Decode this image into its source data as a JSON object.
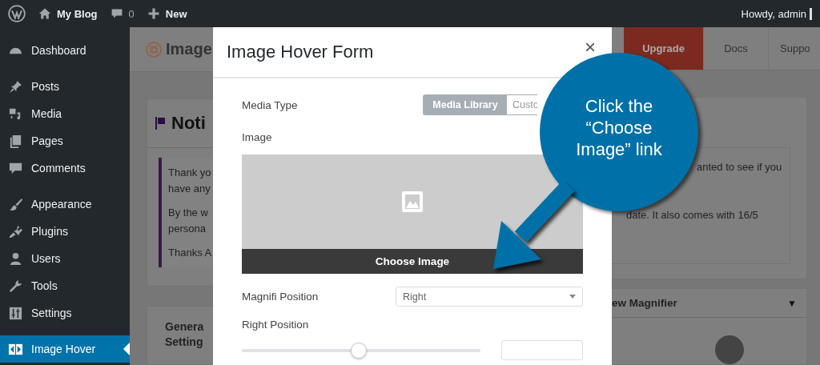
{
  "admin_bar": {
    "site_name": "My Blog",
    "comments_count": "0",
    "new_label": "New",
    "greeting": "Howdy, admin"
  },
  "sidebar": {
    "groups": [
      [
        {
          "label": "Dashboard",
          "selected": false
        }
      ],
      [
        {
          "label": "Posts",
          "selected": false
        },
        {
          "label": "Media",
          "selected": false
        },
        {
          "label": "Pages",
          "selected": false
        },
        {
          "label": "Comments",
          "selected": false
        }
      ],
      [
        {
          "label": "Appearance",
          "selected": false
        },
        {
          "label": "Plugins",
          "selected": false
        },
        {
          "label": "Users",
          "selected": false
        },
        {
          "label": "Tools",
          "selected": false
        },
        {
          "label": "Settings",
          "selected": false
        }
      ],
      [
        {
          "label": "Image Hover",
          "selected": true
        }
      ]
    ]
  },
  "background_page": {
    "logo_text": "Image",
    "tabs": [
      {
        "label": "Upgrade",
        "selected": true
      },
      {
        "label": "Docs",
        "selected": false
      },
      {
        "label": "Suppo",
        "selected": false
      }
    ],
    "notice": {
      "title": "Noti",
      "left_lines": [
        "Thank yo",
        "have any",
        "By the w",
        "persona",
        "Thanks A"
      ],
      "right_lines": [
        "anted to see if you",
        "date. It also comes with 16/5"
      ]
    },
    "settings_card": {
      "title_lines": [
        "Genera",
        "Setting"
      ]
    },
    "preview_panel": {
      "title": "ew Magnifier",
      "toggle": "▼"
    }
  },
  "modal": {
    "title": "Image Hover Form",
    "close": "×",
    "media_type": {
      "label": "Media Type",
      "options": [
        {
          "label": "Media Library",
          "selected": true
        },
        {
          "label": "Custo",
          "selected": false
        }
      ]
    },
    "image": {
      "label": "Image",
      "button": "Choose Image"
    },
    "magnifi_position": {
      "label": "Magnifi Position",
      "value": "Right"
    },
    "right_position": {
      "label": "Right Position",
      "level": 0.49
    }
  },
  "callout": {
    "text": "Click the “Choose Image” link"
  }
}
